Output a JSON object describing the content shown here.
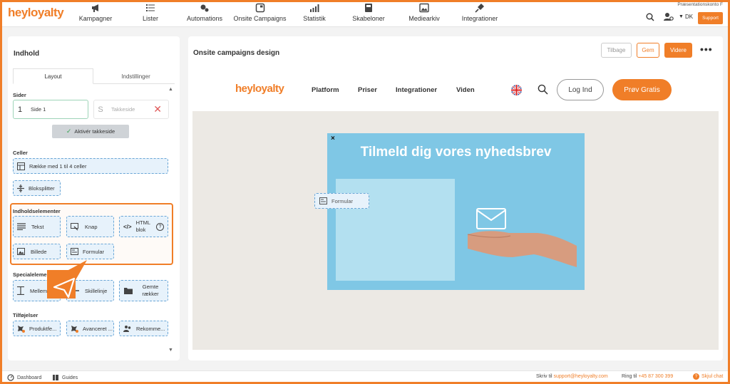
{
  "app": {
    "logo": "heyloyalty"
  },
  "nav": [
    {
      "label": "Kampagner",
      "icon": "megaphone-icon"
    },
    {
      "label": "Lister",
      "icon": "list-icon"
    },
    {
      "label": "Automations",
      "icon": "automation-icon"
    },
    {
      "label": "Onsite Campaigns",
      "icon": "onsite-icon"
    },
    {
      "label": "Statistik",
      "icon": "chart-icon"
    },
    {
      "label": "Skabeloner",
      "icon": "template-icon"
    },
    {
      "label": "Mediearkiv",
      "icon": "image-icon"
    },
    {
      "label": "Integrationer",
      "icon": "plug-icon"
    }
  ],
  "topright": {
    "account": "Præsentationskonto F",
    "lang": "DK",
    "support": "Support"
  },
  "left": {
    "title": "Indhold",
    "tabs": [
      "Layout",
      "Indstillinger"
    ],
    "sider": {
      "heading": "Sider",
      "page1_num": "1",
      "page1_label": "Side 1",
      "page2_num": "S",
      "page2_label": "Takkeside",
      "activate": "Aktivér takkeside"
    },
    "celler": {
      "heading": "Celler",
      "items": [
        "Række med 1 til 4 celler",
        "Bloksplitter"
      ]
    },
    "indhold": {
      "heading": "Indholdselementer",
      "items": [
        "Tekst",
        "Knap",
        "HTML blok",
        "Billede",
        "Formular"
      ]
    },
    "special": {
      "heading": "Specialelementer",
      "items": [
        "Mellemrum",
        "Skillelinje",
        "Gemte rækker"
      ]
    },
    "tilfoejelser": {
      "heading": "Tilføjelser",
      "items": [
        "Produktfe...",
        "Avanceret ...",
        "Rekomme..."
      ]
    }
  },
  "right": {
    "title": "Onsite campaigns design",
    "buttons": {
      "back": "Tilbage",
      "save": "Gem",
      "next": "Videre"
    }
  },
  "site": {
    "logo": "heyloyalty",
    "nav": [
      "Platform",
      "Priser",
      "Integrationer",
      "Viden"
    ],
    "login": "Log Ind",
    "try": "Prøv Gratis"
  },
  "popup": {
    "close": "×",
    "title": "Tilmeld dig vores nyhedsbrev",
    "drag_label": "Formular"
  },
  "bottom": {
    "dashboard": "Dashboard",
    "guides": "Guides",
    "write": "Skriv til",
    "email": "support@heyloyalty.com",
    "call": "Ring til",
    "phone": "+45 87 300 399",
    "hide_chat": "Skjul chat"
  },
  "colors": {
    "accent": "#f07e28",
    "popup_bg": "#7fc7e5",
    "element_bg": "#e7f2fb"
  }
}
